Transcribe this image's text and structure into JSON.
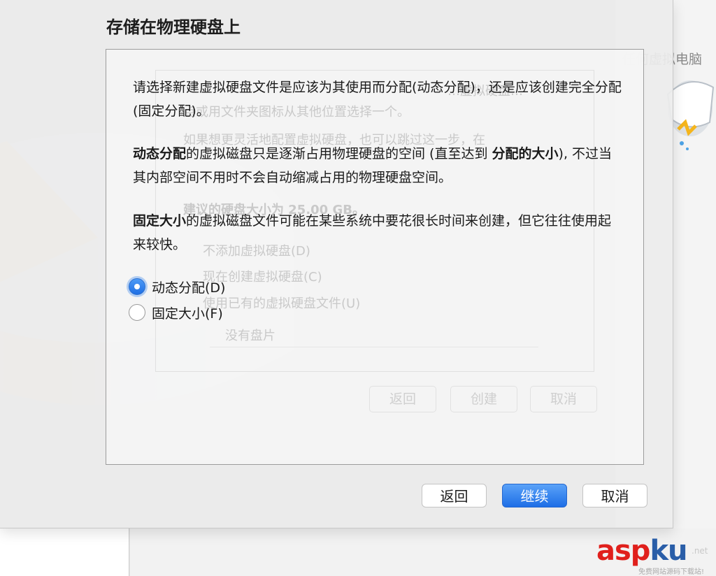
{
  "sheet": {
    "title": "存储在物理硬盘上"
  },
  "description": {
    "p1": "请选择新建虚拟硬盘文件是应该为其使用而分配(动态分配)，还是应该创建完全分配(固定分配)。",
    "p2_bold1": "动态分配",
    "p2_text1": "的虚拟磁盘只是逐渐占用物理硬盘的空间 (直至达到 ",
    "p2_bold2": "分配的大小",
    "p2_text2": "), 不过当其内部空间不用时不会自动缩减占用的物理硬盘空间。",
    "p3_bold": "固定大小",
    "p3_text": "的虚拟磁盘文件可能在某些系统中要花很长时间来创建，但它往往使用起来较快。"
  },
  "options": {
    "dynamic_label": "动态分配(D)",
    "dynamic_checked": true,
    "fixed_label": "固定大小(F)",
    "fixed_checked": false
  },
  "buttons": {
    "back": "返回",
    "continue": "继续",
    "cancel": "取消"
  },
  "background_dialog": {
    "right_title": "任何虚拟电脑",
    "ghost_line1": "…虚拟硬盘…",
    "ghost_line2": "点或用文件夹图标从其他位置选择一个。",
    "ghost_line3": "如果想更灵活地配置虚拟硬盘，也可以跳过这一步，在",
    "ghost_size": "建议的硬盘大小为 25.00 GB。",
    "ghost_opt1": "不添加虚拟硬盘(D)",
    "ghost_opt2": "现在创建虚拟硬盘(C)",
    "ghost_opt3": "使用已有的虚拟硬盘文件(U)",
    "ghost_select": "没有盘片",
    "ghost_back": "返回",
    "ghost_create": "创建",
    "ghost_cancel": "取消"
  },
  "watermark": {
    "part1": "asp",
    "part2": "ku",
    "domain": ".net",
    "subtitle": "免费网站源码下载站!"
  },
  "colors": {
    "accent_blue": "#1f6fe4",
    "watermark_red": "#e0201c",
    "watermark_blue": "#2a5ea8"
  }
}
